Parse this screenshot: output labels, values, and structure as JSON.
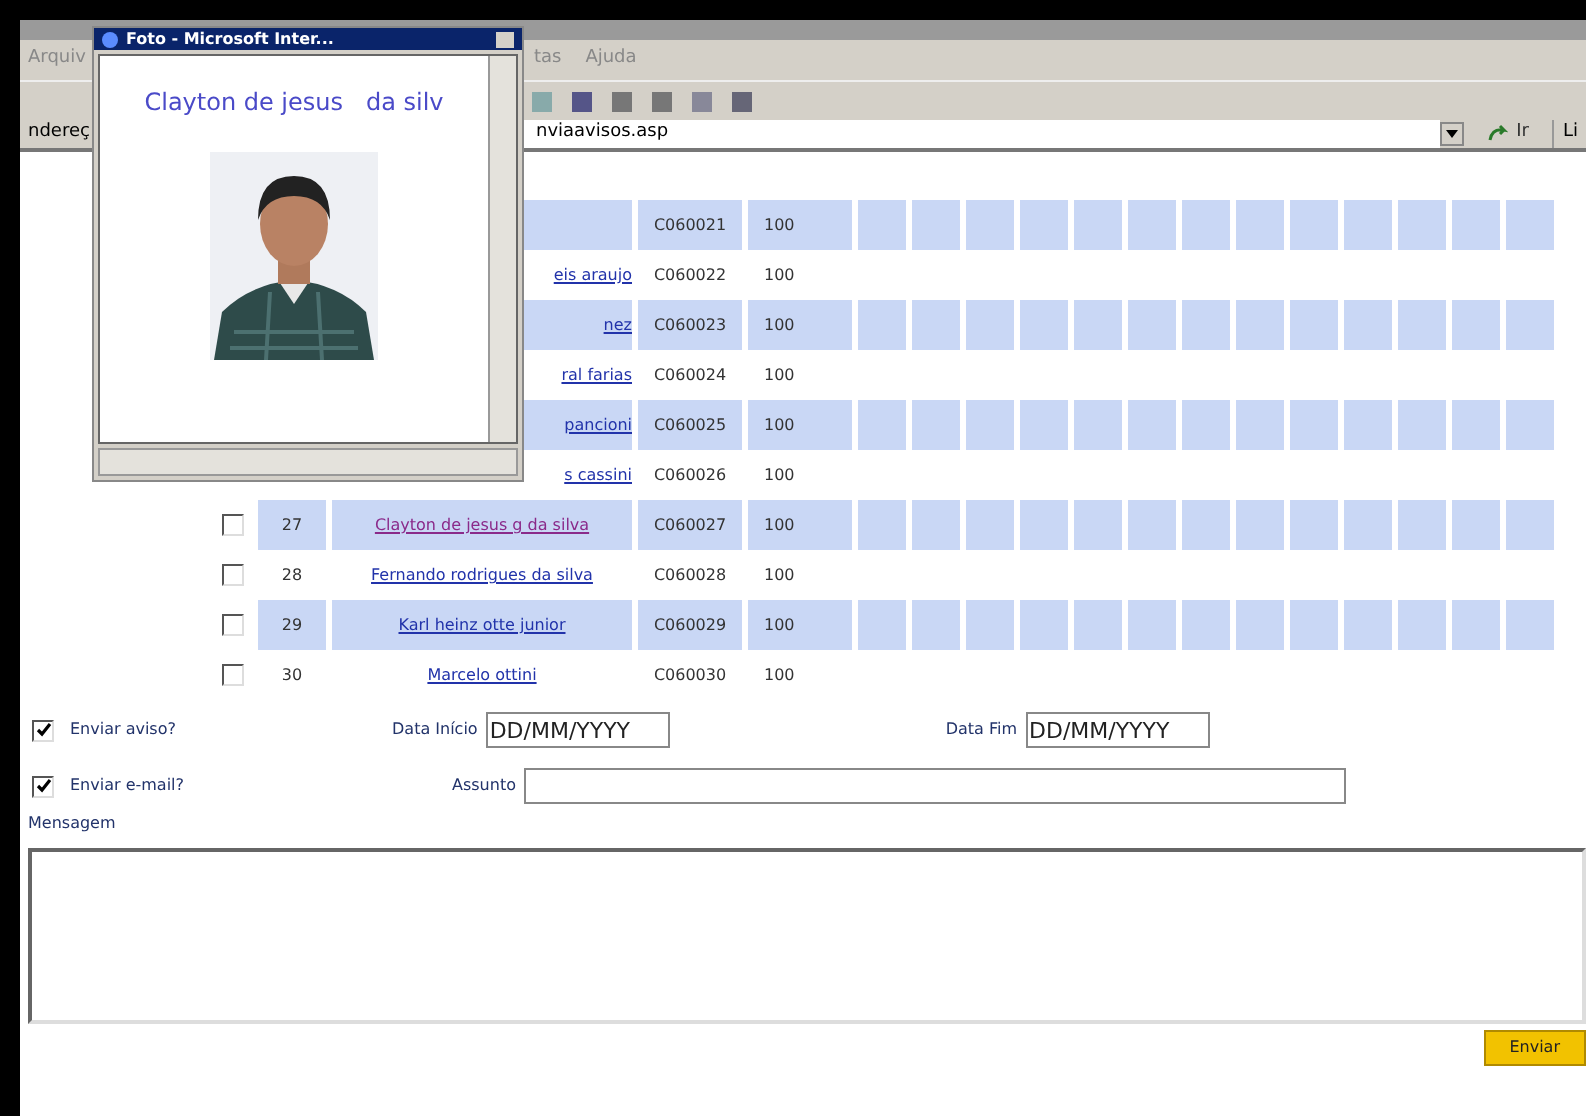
{
  "menu": [
    "Arquiv",
    "tas",
    "Ajuda"
  ],
  "address": {
    "label": "ndereç",
    "url": "nviaavisos.asp",
    "go": "Ir",
    "links": "Li"
  },
  "popup": {
    "title": "Foto - Microsoft Inter...",
    "name": "Clayton de jesus   da silv"
  },
  "table": {
    "rows": [
      {
        "name": "",
        "code": "C060021",
        "value": "100",
        "striped": true
      },
      {
        "name": "eis araujo",
        "code": "C060022",
        "value": "100",
        "striped": false
      },
      {
        "name": "nez",
        "code": "C060023",
        "value": "100",
        "striped": true
      },
      {
        "name": "ral farias",
        "code": "C060024",
        "value": "100",
        "striped": false
      },
      {
        "name": "pancioni",
        "code": "C060025",
        "value": "100",
        "striped": true
      },
      {
        "name": "s cassini",
        "code": "C060026",
        "value": "100",
        "striped": false
      },
      {
        "number": "27",
        "checked": false,
        "name": "Clayton de jesus g da silva",
        "visited": true,
        "code": "C060027",
        "value": "100",
        "striped": true
      },
      {
        "number": "28",
        "checked": false,
        "name": "Fernando rodrigues da silva",
        "visited": false,
        "code": "C060028",
        "value": "100",
        "striped": false
      },
      {
        "number": "29",
        "checked": false,
        "name": "Karl heinz otte junior",
        "visited": false,
        "code": "C060029",
        "value": "100",
        "striped": true
      },
      {
        "number": "30",
        "checked": false,
        "name": "Marcelo ottini",
        "visited": false,
        "code": "C060030",
        "value": "100",
        "striped": false
      }
    ]
  },
  "form": {
    "notice": {
      "label": "Enviar aviso?",
      "checked": true
    },
    "start": {
      "label": "Data Início",
      "value": "DD/MM/YYYY"
    },
    "end": {
      "label": "Data Fim",
      "value": "DD/MM/YYYY"
    },
    "email": {
      "label": "Enviar e-mail?",
      "checked": true
    },
    "subject": {
      "label": "Assunto"
    },
    "message": {
      "label": "Mensagem"
    },
    "submit": "Enviar"
  }
}
